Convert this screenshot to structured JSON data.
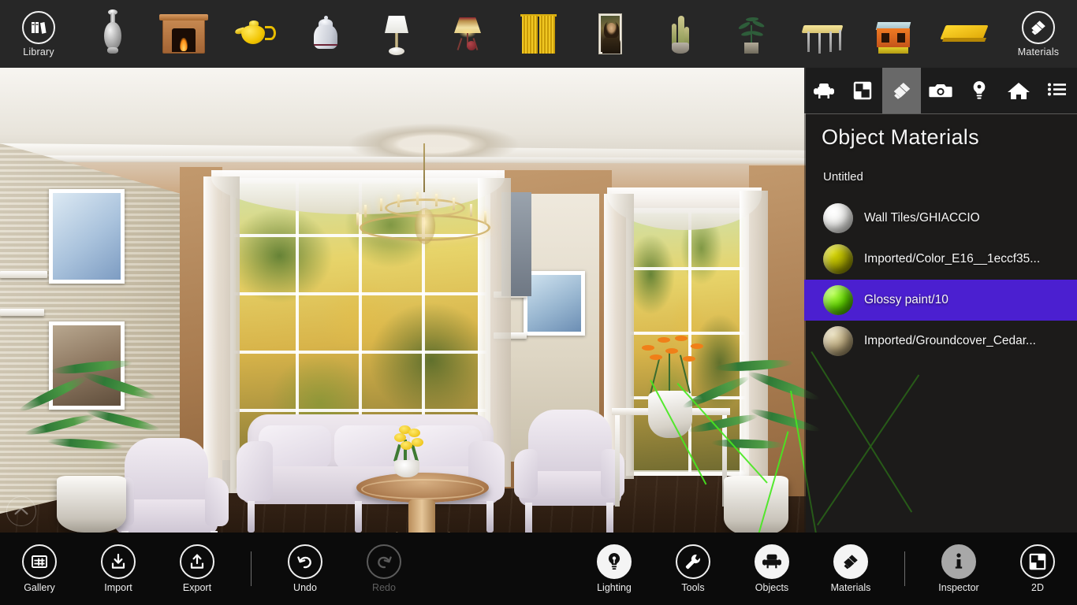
{
  "top_toolbar": {
    "library_button": {
      "label": "Library",
      "icon": "books-icon"
    },
    "materials_button": {
      "label": "Materials",
      "icon": "paintbrush-icon"
    },
    "thumbnails": [
      {
        "name": "silver-vase",
        "label": "Silver Vase"
      },
      {
        "name": "fireplace",
        "label": "Fireplace"
      },
      {
        "name": "yellow-teapot",
        "label": "Yellow Teapot"
      },
      {
        "name": "white-pitcher",
        "label": "White Pitcher"
      },
      {
        "name": "table-lamp",
        "label": "Table Lamp"
      },
      {
        "name": "floor-lamp",
        "label": "Floor Lamp"
      },
      {
        "name": "yellow-curtains",
        "label": "Yellow Curtains"
      },
      {
        "name": "framed-painting",
        "label": "Framed Painting"
      },
      {
        "name": "cactus-plant",
        "label": "Cactus Plant"
      },
      {
        "name": "potted-plant",
        "label": "Potted Plant"
      },
      {
        "name": "yellow-table",
        "label": "Yellow Table"
      },
      {
        "name": "orange-stool",
        "label": "Orange Stool"
      },
      {
        "name": "yellow-board",
        "label": "Yellow Board"
      }
    ]
  },
  "panel": {
    "tabs": [
      {
        "name": "objects-tab",
        "icon": "armchair-icon",
        "active": false
      },
      {
        "name": "floorplan-tab",
        "icon": "floorplan-icon",
        "active": false
      },
      {
        "name": "materials-tab",
        "icon": "paintbrush-icon",
        "active": true
      },
      {
        "name": "camera-tab",
        "icon": "camera-icon",
        "active": false
      },
      {
        "name": "lighting-tab",
        "icon": "lightbulb-icon",
        "active": false
      },
      {
        "name": "home-tab",
        "icon": "home-icon",
        "active": false
      },
      {
        "name": "list-tab",
        "icon": "list-icon",
        "active": false
      }
    ],
    "title": "Object Materials",
    "subtitle": "Untitled",
    "selection_color": "#4b1fd0",
    "materials": [
      {
        "name": "Wall Tiles/GHIACCIO",
        "color": "#f2f2f0",
        "selected": false
      },
      {
        "name": "Imported/Color_E16__1eccf35...",
        "color": "#a8a800",
        "selected": false
      },
      {
        "name": "Glossy paint/10",
        "color": "#5fd400",
        "selected": true
      },
      {
        "name": "Imported/Groundcover_Cedar...",
        "color": "#b8a57a",
        "selected": false
      }
    ]
  },
  "viewport": {
    "collapse_button": {
      "name": "collapse-panel-button",
      "icon": "chevron-up-icon"
    }
  },
  "bottom_bar": {
    "left_group": [
      {
        "label": "Gallery",
        "icon": "gallery-icon",
        "style": "outline",
        "disabled": false
      },
      {
        "label": "Import",
        "icon": "download-icon",
        "style": "outline",
        "disabled": false
      },
      {
        "label": "Export",
        "icon": "upload-icon",
        "style": "outline",
        "disabled": false
      }
    ],
    "history_group": [
      {
        "label": "Undo",
        "icon": "undo-arrow-icon",
        "style": "outline",
        "disabled": false
      },
      {
        "label": "Redo",
        "icon": "redo-arrow-icon",
        "style": "outline",
        "disabled": true
      }
    ],
    "tools_group": [
      {
        "label": "Lighting",
        "icon": "lightbulb-icon",
        "style": "filled",
        "disabled": false
      },
      {
        "label": "Tools",
        "icon": "wrench-icon",
        "style": "outline",
        "disabled": false
      },
      {
        "label": "Objects",
        "icon": "armchair-icon",
        "style": "filled",
        "disabled": false
      },
      {
        "label": "Materials",
        "icon": "paintbrush-icon",
        "style": "filled",
        "disabled": false
      }
    ],
    "right_group": [
      {
        "label": "Inspector",
        "icon": "info-icon",
        "style": "grayfill",
        "disabled": false
      },
      {
        "label": "2D",
        "icon": "floorplan-icon",
        "style": "outline",
        "disabled": false
      }
    ]
  }
}
